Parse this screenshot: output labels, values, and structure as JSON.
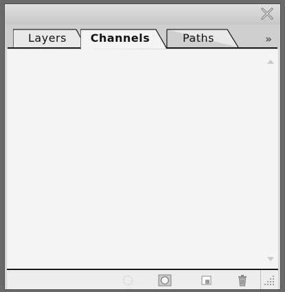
{
  "window": {
    "close_icon": "close-icon"
  },
  "tabs": [
    {
      "label": "Layers",
      "active": false
    },
    {
      "label": "Channels",
      "active": true
    },
    {
      "label": "Paths",
      "active": false
    }
  ],
  "panel_menu": {
    "glyph": "»",
    "icon": "panel-menu-icon"
  },
  "channels_list": {
    "items": []
  },
  "toolbar": {
    "buttons": [
      {
        "icon": "load-channel-as-selection-icon",
        "enabled": false
      },
      {
        "icon": "save-selection-as-channel-icon",
        "enabled": true
      },
      {
        "icon": "create-new-channel-icon",
        "enabled": true
      },
      {
        "icon": "delete-channel-icon",
        "enabled": true
      }
    ]
  },
  "colors": {
    "panel_bg": "#d6d6d6",
    "content_bg": "#f4f4f4",
    "divider": "#1a1a1a"
  }
}
